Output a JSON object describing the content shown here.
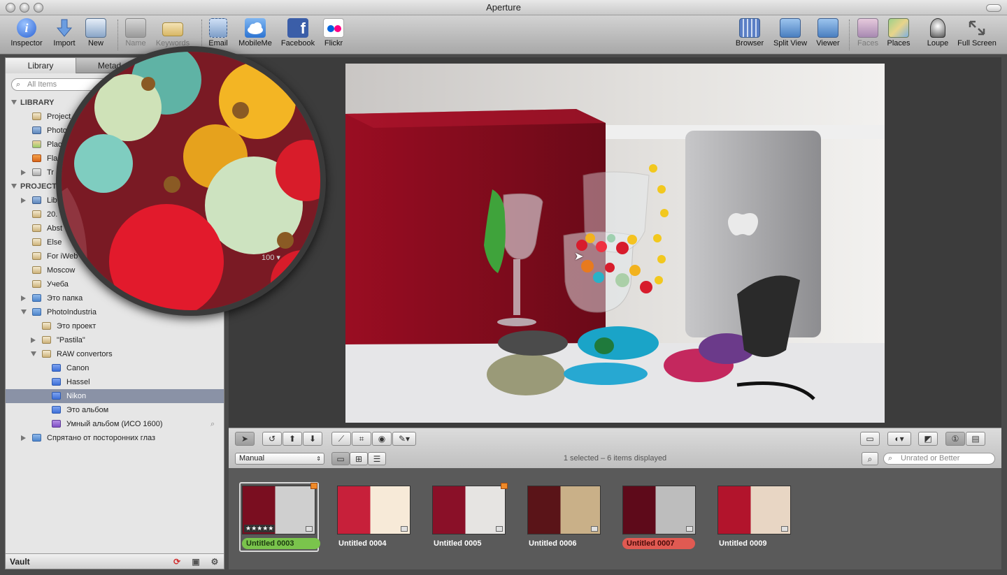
{
  "app": {
    "title": "Aperture"
  },
  "toolbar": {
    "inspector": "Inspector",
    "import": "Import",
    "new": "New",
    "name": "Name",
    "keywords": "Keywords",
    "email": "Email",
    "mobileme": "MobileMe",
    "facebook": "Facebook",
    "flickr": "Flickr",
    "browser": "Browser",
    "split_view": "Split View",
    "viewer": "Viewer",
    "faces": "Faces",
    "places": "Places",
    "loupe": "Loupe",
    "full_screen": "Full Screen"
  },
  "sidebar": {
    "tabs": [
      "Library",
      "Metad"
    ],
    "search_placeholder": "All Items",
    "library_header": "LIBRARY",
    "library_items": [
      "Project",
      "Photo",
      "Plac",
      "Fla",
      "Tr"
    ],
    "projects_header": "PROJECT",
    "project_items": [
      "Lib",
      "20.",
      "Abst",
      "Else",
      "For iWeb",
      "Moscow",
      "Учеба",
      "Это папка",
      "PhotoIndustria",
      "Это проект",
      "\"Pastila\"",
      "RAW convertors",
      "Canon",
      "Hassel",
      "Nikon",
      "Это альбом",
      "Умный альбом (ИСО 1600)",
      "Спрятано от посторонних глаз"
    ],
    "vault": "Vault"
  },
  "loupe": {
    "zoom": "100"
  },
  "controls": {
    "sort": "Manual",
    "status": "1 selected – 6 items displayed",
    "filter_placeholder": "Unrated or Better"
  },
  "thumbnails": [
    {
      "label": "Untitled 0003",
      "rating": "★★★★★"
    },
    {
      "label": "Untitled 0004"
    },
    {
      "label": "Untitled 0005"
    },
    {
      "label": "Untitled 0006"
    },
    {
      "label": "Untitled 0007"
    },
    {
      "label": "Untitled 0009"
    }
  ]
}
